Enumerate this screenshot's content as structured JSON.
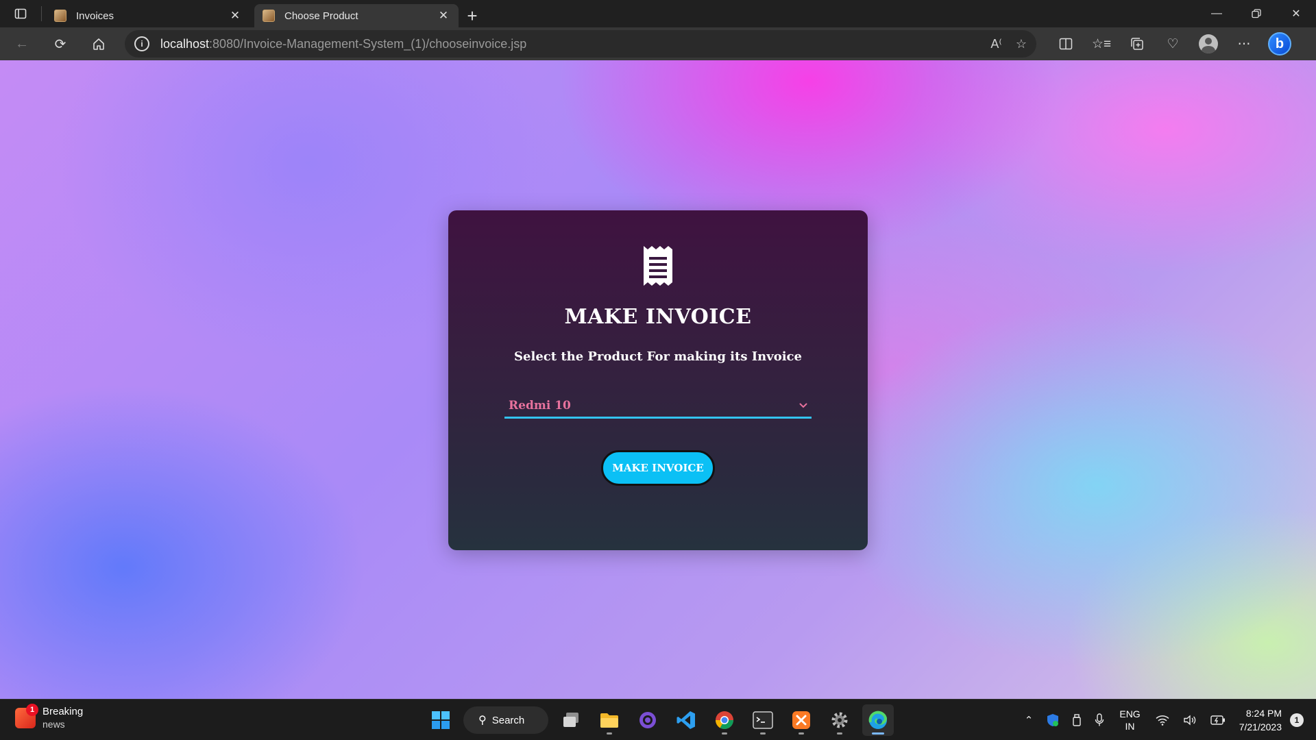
{
  "browser": {
    "tabs": [
      {
        "label": "Invoices",
        "active": false
      },
      {
        "label": "Choose Product",
        "active": true
      }
    ],
    "address": {
      "host": "localhost",
      "path": ":8080/Invoice-Management-System_(1)/chooseinvoice.jsp"
    }
  },
  "card": {
    "title": "MAKE INVOICE",
    "subtitle": "Select the Product For making its Invoice",
    "product_select": {
      "selected": "Redmi 10"
    },
    "submit_label": "MAKE INVOICE"
  },
  "colors": {
    "card_top": "#3f1240",
    "card_bottom": "#26323e",
    "accent_underline": "#33c3f0",
    "select_text": "#e8729d",
    "button_bg": "#0bc0f5"
  },
  "taskbar": {
    "news_title": "Breaking",
    "news_sub": "news",
    "news_badge": "1",
    "search_label": "Search",
    "lang_primary": "ENG",
    "lang_secondary": "IN",
    "time": "8:24 PM",
    "date": "7/21/2023",
    "notification_count": "1"
  }
}
